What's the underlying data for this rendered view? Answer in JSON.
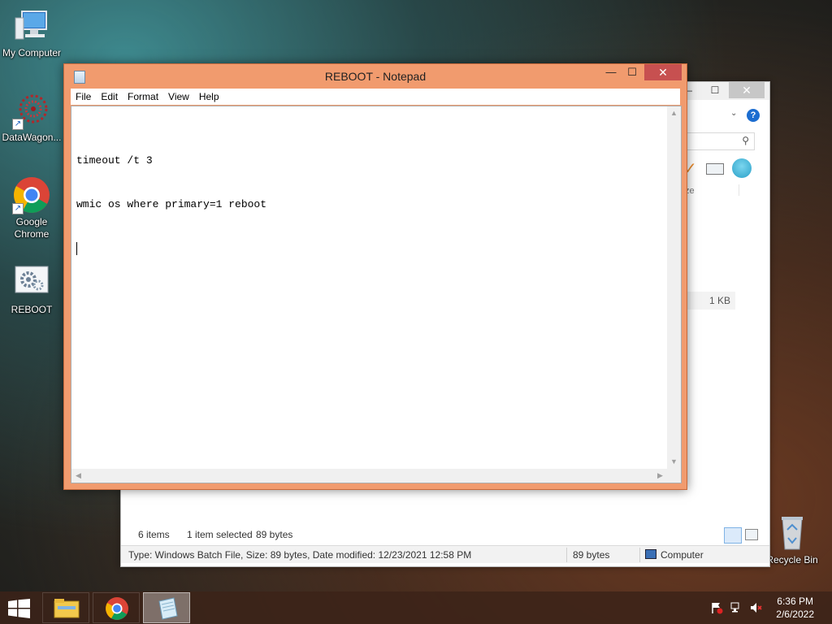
{
  "desktop": {
    "icons": [
      {
        "label": "My Computer"
      },
      {
        "label": "DataWagon..."
      },
      {
        "label": "Google Chrome"
      },
      {
        "label": "REBOOT"
      },
      {
        "label": "Recycle Bin"
      }
    ]
  },
  "explorer": {
    "min_glyph": "—",
    "max_glyph": "☐",
    "close_glyph": "✕",
    "column_fragment": "ze",
    "size_value": "1 KB",
    "status": {
      "items": "6 items",
      "selected": "1 item selected",
      "selected_size": "89 bytes"
    },
    "details": {
      "description": "Type: Windows Batch File, Size: 89 bytes, Date modified: 12/23/2021 12:58 PM",
      "size": "89 bytes",
      "location": "Computer"
    }
  },
  "notepad": {
    "title": "REBOOT - Notepad",
    "min_glyph": "—",
    "max_glyph": "☐",
    "close_glyph": "✕",
    "menu": [
      "File",
      "Edit",
      "Format",
      "View",
      "Help"
    ],
    "lines": [
      "timeout /t 3",
      "wmic os where primary=1 reboot"
    ]
  },
  "taskbar": {
    "time": "6:36 PM",
    "date": "2/6/2022"
  },
  "colors": {
    "notepad_frame": "#f19b6e",
    "close_button": "#c75050"
  }
}
